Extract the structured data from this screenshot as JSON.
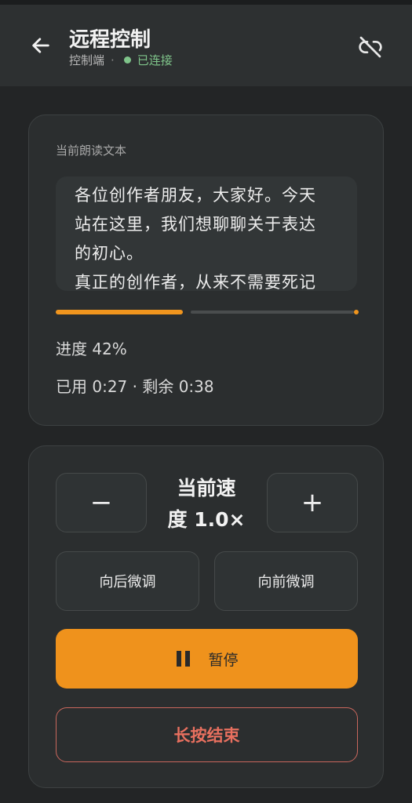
{
  "header": {
    "title": "远程控制",
    "role": "控制端",
    "separator": "·",
    "status": "已连接"
  },
  "reading": {
    "label": "当前朗读文本",
    "lines": [
      "各位创作者朋友，大家好。今天",
      "站在这里，我们想聊聊关于表达",
      "的初心。",
      "真正的创作者，从来不需要死记"
    ],
    "progress_fraction": 0.42,
    "progress_text": "进度 42%",
    "time_text": "已用 0:27 · 剩余 0:38"
  },
  "controls": {
    "minus": "−",
    "plus": "+",
    "speed_line1": "当前速",
    "speed_line2": "度 1.0×",
    "nudge_back": "向后微调",
    "nudge_forward": "向前微调",
    "pause": "暂停",
    "end": "长按结束"
  },
  "colors": {
    "accent": "#ef921c",
    "connected": "#7fc48a",
    "danger": "#e8705f"
  },
  "icons": {
    "back": "arrow-left-icon",
    "unlink": "link-off-icon",
    "pause": "pause-icon"
  }
}
